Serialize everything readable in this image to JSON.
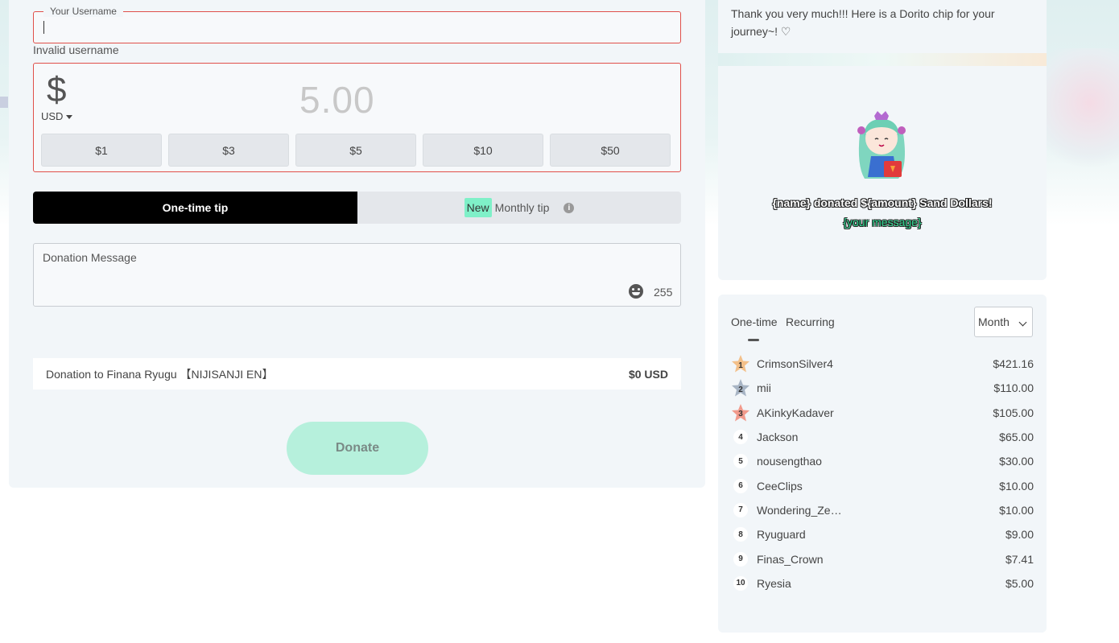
{
  "form": {
    "username_legend": "Your Username",
    "invalid_text": "Invalid username",
    "currency_symbol": "$",
    "currency_code": "USD",
    "amount_placeholder": "5.00",
    "presets": [
      "$1",
      "$3",
      "$5",
      "$10",
      "$50"
    ],
    "tip_onetime": "One-time tip",
    "tip_new_badge": "New",
    "tip_monthly": "Monthly tip",
    "info_glyph": "i",
    "message_placeholder": "Donation Message",
    "char_count": "255",
    "summary_label": "Donation to Finana Ryugu 【NIJISANJI EN】",
    "summary_amount": "$0 USD",
    "donate_label": "Donate"
  },
  "thanks": {
    "text": "Thank you very much!!! Here is a Dorito chip for your journey~! ♡"
  },
  "preview": {
    "line1": "{name} donated ${amount} Sand Dollars!",
    "line2": "{your message}"
  },
  "leaderboard": {
    "tab_onetime": "One-time",
    "tab_recurring": "Recurring",
    "period": "Month",
    "medal_colors": [
      "#f3c08a",
      "#a7b4c4",
      "#f19a8c"
    ],
    "rows": [
      {
        "rank": "1",
        "name": "CrimsonSilver4",
        "amount": "$421.16"
      },
      {
        "rank": "2",
        "name": "mii",
        "amount": "$110.00"
      },
      {
        "rank": "3",
        "name": "AKinkyKadaver",
        "amount": "$105.00"
      },
      {
        "rank": "4",
        "name": "Jackson",
        "amount": "$65.00"
      },
      {
        "rank": "5",
        "name": "nousengthao",
        "amount": "$30.00"
      },
      {
        "rank": "6",
        "name": "CeeClips",
        "amount": "$10.00"
      },
      {
        "rank": "7",
        "name": "Wondering_Ze…",
        "amount": "$10.00"
      },
      {
        "rank": "8",
        "name": "Ryuguard",
        "amount": "$9.00"
      },
      {
        "rank": "9",
        "name": "Finas_Crown",
        "amount": "$7.41"
      },
      {
        "rank": "10",
        "name": "Ryesia",
        "amount": "$5.00"
      }
    ]
  }
}
